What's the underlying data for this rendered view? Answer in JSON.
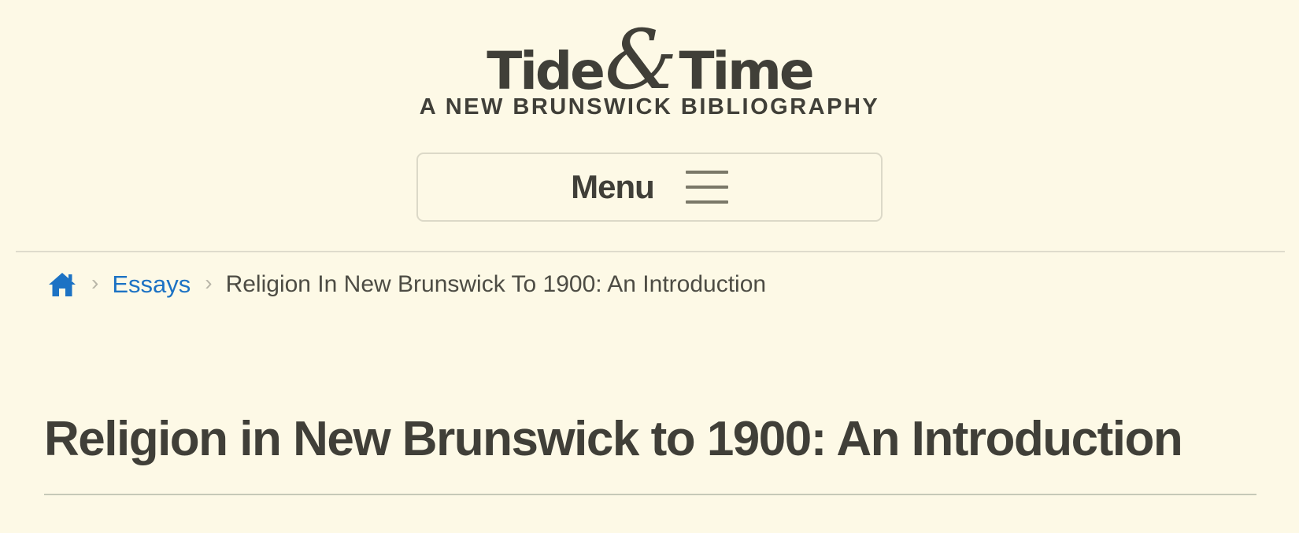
{
  "header": {
    "logo": {
      "word1": "Tide",
      "ampersand": "&",
      "word2": "Time",
      "subtitle": "A NEW BRUNSWICK BIBLIOGRAPHY"
    },
    "menu_label": "Menu"
  },
  "breadcrumb": {
    "home_icon": "home-icon",
    "separator": "›",
    "items": [
      {
        "label": "Essays"
      },
      {
        "label": "Religion In New Brunswick To 1900: An Introduction"
      }
    ]
  },
  "main": {
    "title": "Religion in New Brunswick to 1900: An Introduction"
  },
  "colors": {
    "background": "#fdf9e6",
    "text": "#403f38",
    "link": "#1c72c4",
    "divider": "#dfdccc"
  }
}
